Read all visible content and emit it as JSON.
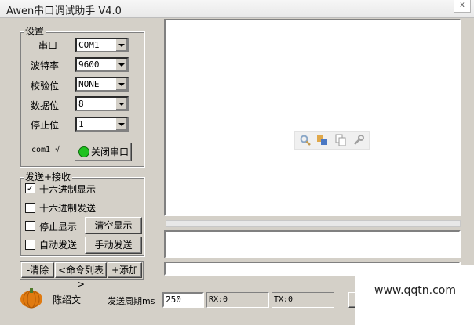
{
  "window": {
    "title": "Awen串口调试助手 V4.0",
    "close_glyph": "x"
  },
  "settings": {
    "group_title": "设置",
    "fields": [
      {
        "label": "串口",
        "value": "COM1"
      },
      {
        "label": "波特率",
        "value": "9600"
      },
      {
        "label": "校验位",
        "value": "NONE"
      },
      {
        "label": "数据位",
        "value": "8"
      },
      {
        "label": "停止位",
        "value": "1"
      }
    ],
    "port_status": "com1 √",
    "toggle_port_button": "关闭串口",
    "indicator_color": "#1fc21f"
  },
  "send_receive": {
    "group_title": "发送+接收",
    "options": [
      {
        "label": "十六进制显示",
        "checked": true
      },
      {
        "label": "十六进制发送",
        "checked": false
      },
      {
        "label": "停止显示",
        "checked": false
      },
      {
        "label": "自动发送",
        "checked": false
      }
    ],
    "clear_display_button": "清空显示",
    "manual_send_button": "手动发送"
  },
  "command_bar": {
    "clear": "-清除",
    "list": "<命令列表>",
    "add": "+添加"
  },
  "footer": {
    "author": "陈绍文",
    "period_label": "发送周期ms",
    "period_value": "250",
    "rx": "RX:0",
    "tx": "TX:0"
  },
  "watermark": "www.qqtn.com",
  "icons": [
    "magnifier-icon",
    "transfer-icon",
    "copy-icon",
    "wrench-icon",
    "pumpkin-icon"
  ]
}
